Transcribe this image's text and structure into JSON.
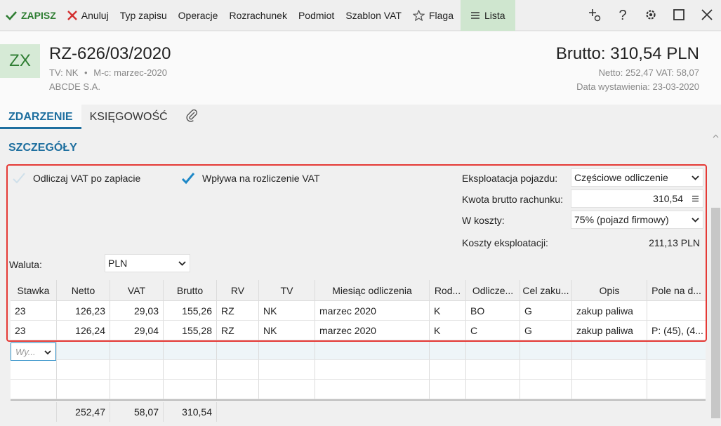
{
  "toolbar": {
    "save": "ZAPISZ",
    "cancel": "Anuluj",
    "entry_type": "Typ zapisu",
    "operations": "Operacje",
    "settlement": "Rozrachunek",
    "subject": "Podmiot",
    "vat_template": "Szablon VAT",
    "flag": "Flaga",
    "list": "Lista"
  },
  "header": {
    "badge": "ZX",
    "title": "RZ-626/03/2020",
    "sub_tv": "TV: NK",
    "sub_sep": "•",
    "sub_month": "M-c: marzec-2020",
    "company": "ABCDE S.A.",
    "brutto": "Brutto: 310,54 PLN",
    "netto_vat": "Netto: 252,47 VAT: 58,07",
    "issue_date": "Data wystawienia: 23-03-2020"
  },
  "tabs": {
    "event": "ZDARZENIE",
    "accounting": "KSIĘGOWOŚĆ"
  },
  "section": {
    "title": "SZCZEGÓŁY"
  },
  "form": {
    "deduct_vat_label": "Odliczaj VAT po zapłacie",
    "deduct_vat_checked": false,
    "affects_vat_label": "Wpływa na rozliczenie VAT",
    "affects_vat_checked": true,
    "vehicle_use_label": "Eksploatacja pojazdu:",
    "vehicle_use_value": "Częściowe odliczenie",
    "gross_amount_label": "Kwota brutto rachunku:",
    "gross_amount_value": "310,54",
    "costs_label": "W koszty:",
    "costs_value": "75% (pojazd firmowy)",
    "operating_costs_label": "Koszty eksploatacji:",
    "operating_costs_value": "211,13 PLN",
    "currency_label": "Waluta:",
    "currency_value": "PLN"
  },
  "table": {
    "columns": [
      "Stawka",
      "Netto",
      "VAT",
      "Brutto",
      "RV",
      "TV",
      "Miesiąc odliczenia",
      "Rod...",
      "Odlicze...",
      "Cel zaku...",
      "Opis",
      "Pole na d..."
    ],
    "rows": [
      [
        "23",
        "126,23",
        "29,03",
        "155,26",
        "RZ",
        "NK",
        "marzec 2020",
        "K",
        "BO",
        "G",
        "zakup paliwa",
        ""
      ],
      [
        "23",
        "126,24",
        "29,04",
        "155,28",
        "RZ",
        "NK",
        "marzec 2020",
        "K",
        "C",
        "G",
        "zakup paliwa",
        "P: (45), (4..."
      ]
    ],
    "new_row_placeholder": "Wy...",
    "totals": {
      "netto": "252,47",
      "vat": "58,07",
      "brutto": "310,54"
    }
  },
  "colors": {
    "accent": "#1e6f9f",
    "save_green": "#2e7d32",
    "cancel_red": "#d32f2f",
    "outline_red": "#e53935",
    "list_bg": "#cfe6cf"
  }
}
